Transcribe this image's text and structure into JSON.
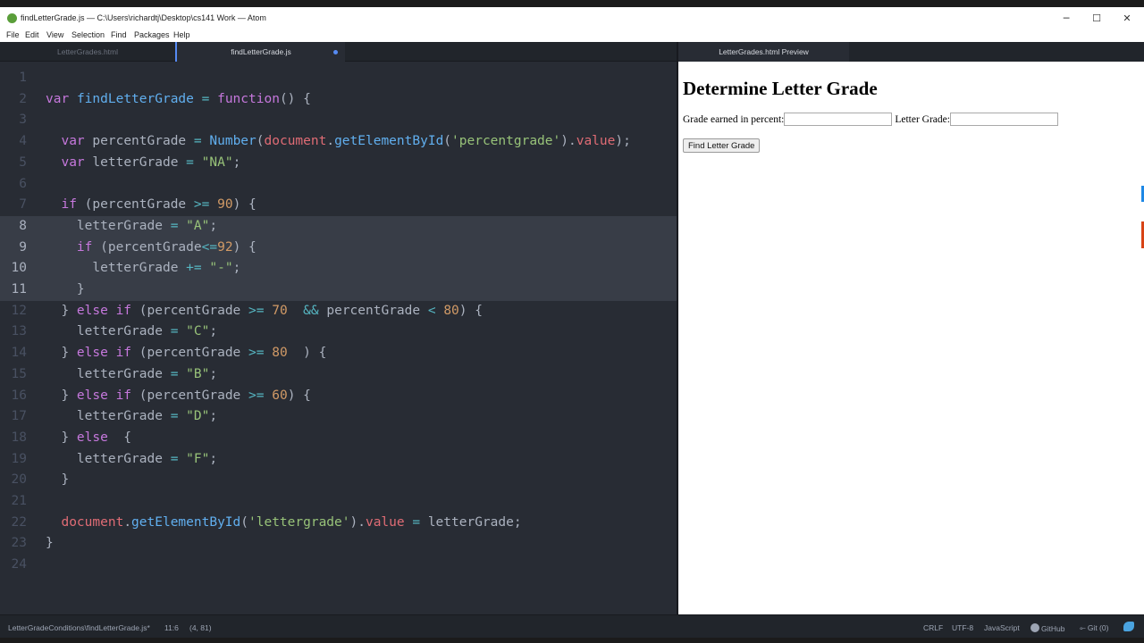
{
  "window": {
    "title": "findLetterGrade.js — C:\\Users\\richardtj\\Desktop\\cs141 Work — Atom",
    "minimize": "─",
    "maximize": "☐",
    "close": "✕"
  },
  "menu": [
    "File",
    "Edit",
    "View",
    "Selection",
    "Find",
    "Packages",
    "Help"
  ],
  "tabs": [
    {
      "label": "LetterGrades.html",
      "active": false
    },
    {
      "label": "findLetterGrade.js",
      "active": true,
      "modified": true
    }
  ],
  "editor": {
    "language": "JavaScript",
    "line_numbers": [
      "1",
      "2",
      "3",
      "4",
      "5",
      "6",
      "7",
      "8",
      "9",
      "10",
      "11",
      "12",
      "13",
      "14",
      "15",
      "16",
      "17",
      "18",
      "19",
      "20",
      "21",
      "22",
      "23",
      "24"
    ],
    "selected_lines": [
      8,
      9,
      10,
      11
    ],
    "code": [
      "",
      "var findLetterGrade = function() {",
      "",
      "  var percentGrade = Number(document.getElementById('percentgrade').value);",
      "  var letterGrade = \"NA\";",
      "",
      "  if (percentGrade >= 90) {",
      "    letterGrade = \"A\";",
      "    if (percentGrade<=92) {",
      "      letterGrade += \"-\";",
      "    }",
      "  } else if (percentGrade >= 70  && percentGrade < 80) {",
      "    letterGrade = \"C\";",
      "  } else if (percentGrade >= 80  ) {",
      "    letterGrade = \"B\";",
      "  } else if (percentGrade >= 60) {",
      "    letterGrade = \"D\";",
      "  } else  {",
      "    letterGrade = \"F\";",
      "  }",
      "",
      "  document.getElementById('lettergrade').value = letterGrade;",
      "}",
      ""
    ]
  },
  "preview": {
    "tab_label": "LetterGrades.html Preview",
    "heading": "Determine Letter Grade",
    "grade_label": "Grade earned in percent:",
    "grade_value": "",
    "letter_label": "Letter Grade:",
    "letter_value": "",
    "button_label": "Find Letter Grade"
  },
  "status": {
    "file_path": "LetterGradeConditions\\findLetterGrade.js*",
    "cursor": "11:6",
    "selection": "(4, 81)",
    "line_ending": "CRLF",
    "encoding": "UTF-8",
    "grammar": "JavaScript",
    "github": "GitHub",
    "git": "Git (0)"
  }
}
